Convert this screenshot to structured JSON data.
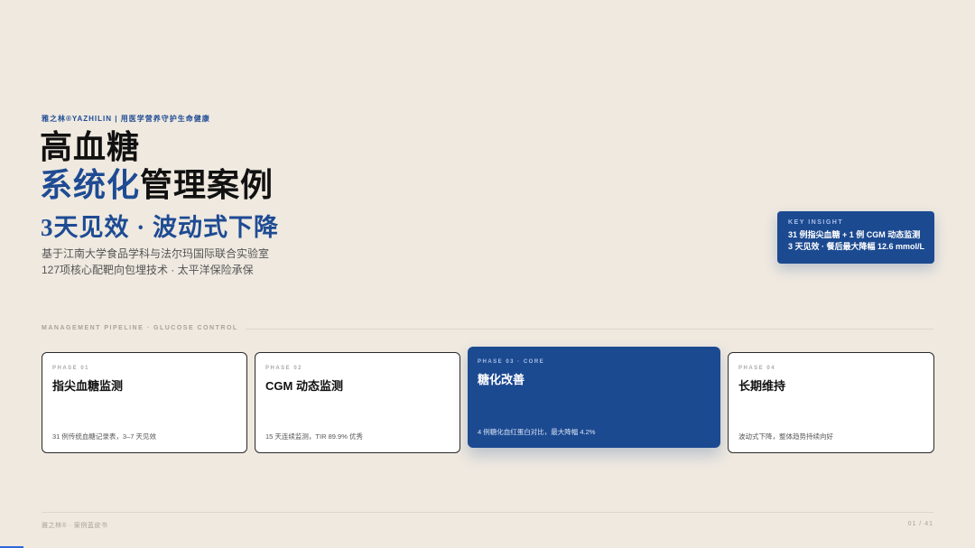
{
  "header": {
    "brand_line": "雅之林®YAZHILIN | 用医学营养守护生命健康",
    "title_line1": "高血糖",
    "title_line2_accent": "系统化",
    "title_line2_rest": "管理案例",
    "subtitle": "3天见效 · 波动式下降",
    "desc_line1": "基于江南大学食品学科与法尔玛国际联合实验室",
    "desc_line2": "127项核心配靶向包埋技术 · 太平洋保险承保"
  },
  "insight": {
    "kicker": "KEY INSIGHT",
    "line1": "31 例指尖血糖 + 1 例 CGM 动态监测",
    "line2": "3 天见效 · 餐后最大降幅 12.6 mmol/L"
  },
  "pipeline": {
    "label": "MANAGEMENT PIPELINE · GLUCOSE CONTROL",
    "phases": [
      {
        "phase": "PHASE 01",
        "name": "指尖血糖监测",
        "note": "31 例传统血糖记录表，3–7 天见效"
      },
      {
        "phase": "PHASE 02",
        "name": "CGM 动态监测",
        "note": "15 天连续监测，TIR 89.9% 优秀"
      },
      {
        "phase": "PHASE 03 · CORE",
        "name": "糖化改善",
        "note": "4 例糖化血红蛋白对比，最大降幅 4.2%"
      },
      {
        "phase": "PHASE 04",
        "name": "长期维持",
        "note": "波动式下降，整体趋势持续向好"
      }
    ]
  },
  "footer": {
    "left": "雅之林® · 案例蓝皮书",
    "page": "01 / 41"
  },
  "colors": {
    "background": "#efe9e0",
    "accent_blue": "#1c4a91",
    "progress_blue": "#2e67d8"
  },
  "slide_progress": 0.024
}
